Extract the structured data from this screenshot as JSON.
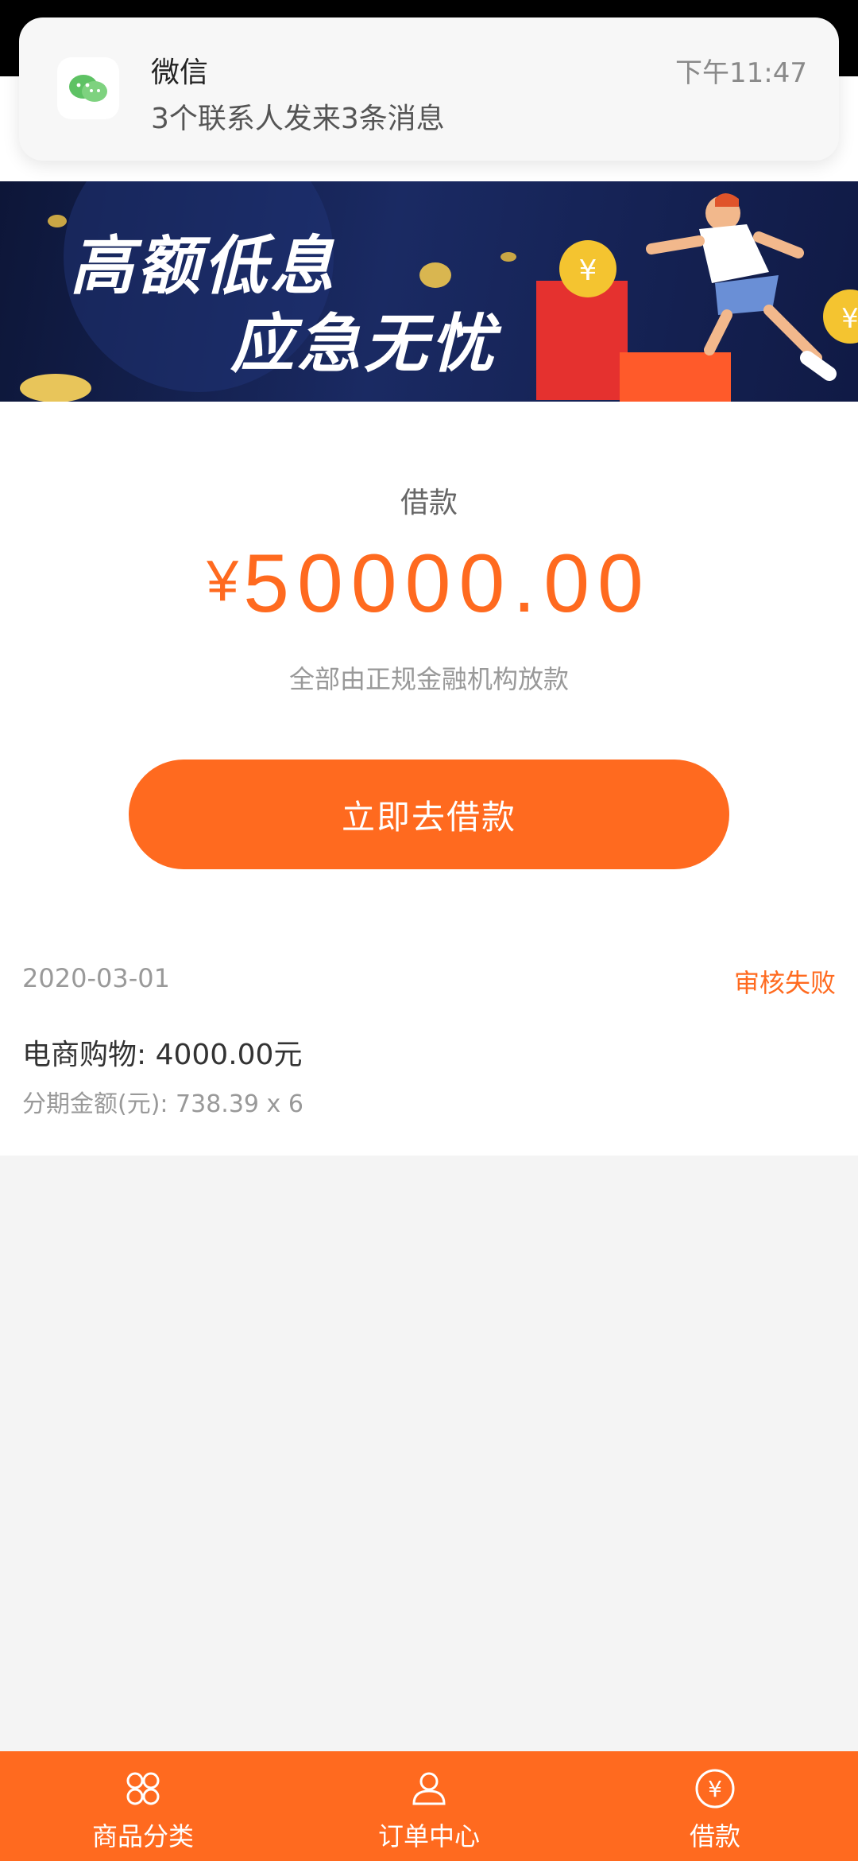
{
  "notification": {
    "app_name": "微信",
    "time": "下午11:47",
    "message": "3个联系人发来3条消息"
  },
  "nav": {
    "title": "借款"
  },
  "banner": {
    "line1": "高额低息",
    "line2": "应急无忧"
  },
  "loan": {
    "label": "借款",
    "currency_symbol": "¥",
    "amount": "50000.00",
    "subtitle": "全部由正规金融机构放款",
    "button_label": "立即去借款"
  },
  "record": {
    "date": "2020-03-01",
    "status": "审核失败",
    "title": "电商购物: 4000.00元",
    "installment": "分期金额(元): 738.39 x 6"
  },
  "tabs": [
    {
      "label": "商品分类",
      "icon": "grid-icon"
    },
    {
      "label": "订单中心",
      "icon": "user-icon"
    },
    {
      "label": "借款",
      "icon": "yen-icon"
    }
  ],
  "colors": {
    "accent": "#ff6a1f",
    "background": "#f4f4f4"
  }
}
